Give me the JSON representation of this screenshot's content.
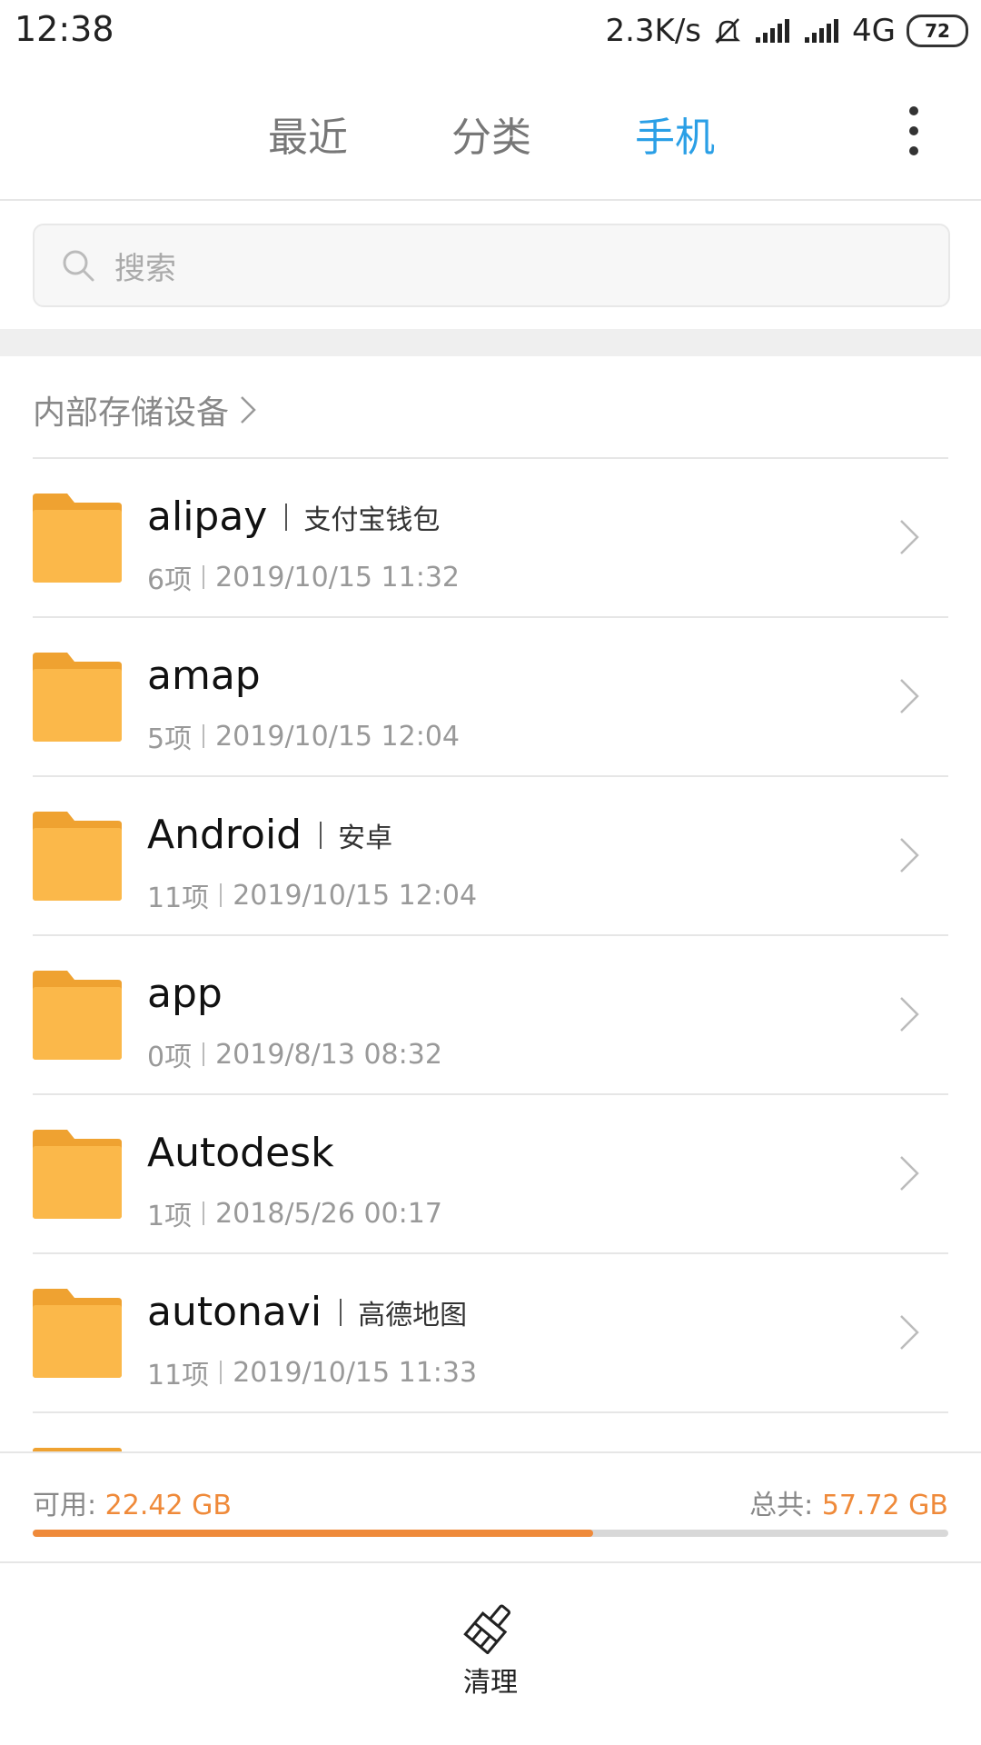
{
  "status_bar": {
    "time": "12:38",
    "net_speed": "2.3K/s",
    "network": "4G",
    "battery": "72"
  },
  "tabs": [
    {
      "label": "最近"
    },
    {
      "label": "分类"
    },
    {
      "label": "手机"
    }
  ],
  "active_tab": "手机",
  "search": {
    "placeholder": "搜索"
  },
  "breadcrumb": {
    "label": "内部存储设备"
  },
  "files": [
    {
      "name": "alipay",
      "alias": "支付宝钱包",
      "count": "6项",
      "date": "2019/10/15 11:32"
    },
    {
      "name": "amap",
      "alias": "",
      "count": "5项",
      "date": "2019/10/15 12:04"
    },
    {
      "name": "Android",
      "alias": "安卓",
      "count": "11项",
      "date": "2019/10/15 12:04"
    },
    {
      "name": "app",
      "alias": "",
      "count": "0项",
      "date": "2019/8/13 08:32"
    },
    {
      "name": "Autodesk",
      "alias": "",
      "count": "1项",
      "date": "2018/5/26 00:17"
    },
    {
      "name": "autonavi",
      "alias": "高德地图",
      "count": "11项",
      "date": "2019/10/15 11:33"
    }
  ],
  "storage": {
    "available_label": "可用:",
    "available_value": "22.42 GB",
    "total_label": "总共:",
    "total_value": "57.72 GB",
    "used_fraction": 0.612
  },
  "bottom_action": {
    "label": "清理"
  },
  "colors": {
    "accent_blue": "#2a9fe6",
    "accent_orange": "#ef8a3a",
    "folder": "#fbb84a"
  },
  "icons": {
    "more": "more-vertical-icon",
    "search": "search-icon",
    "folder": "folder-icon",
    "chevron": "chevron-right-icon",
    "clean": "broom-icon"
  }
}
